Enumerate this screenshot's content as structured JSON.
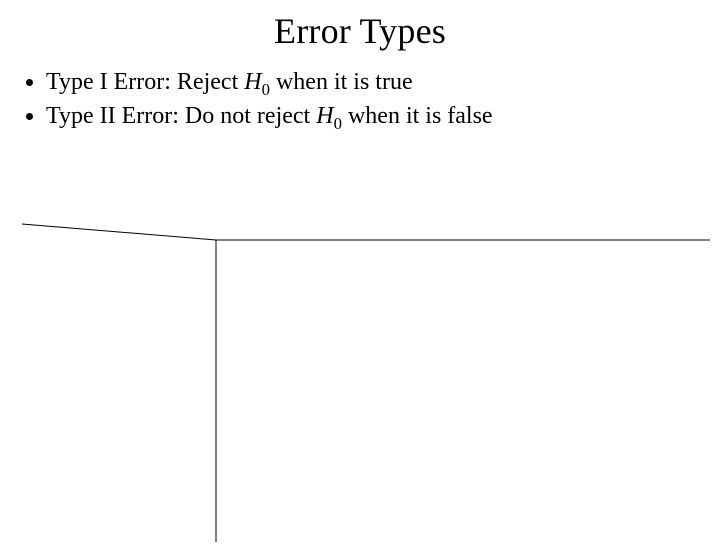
{
  "title": "Error Types",
  "bullets": [
    {
      "prefix": "Type I Error: Reject ",
      "symbol": "H",
      "sub": "0",
      "suffix": " when it is true"
    },
    {
      "prefix": "Type II Error: Do not reject ",
      "symbol": "H",
      "sub": "0",
      "suffix": " when it is false"
    }
  ]
}
